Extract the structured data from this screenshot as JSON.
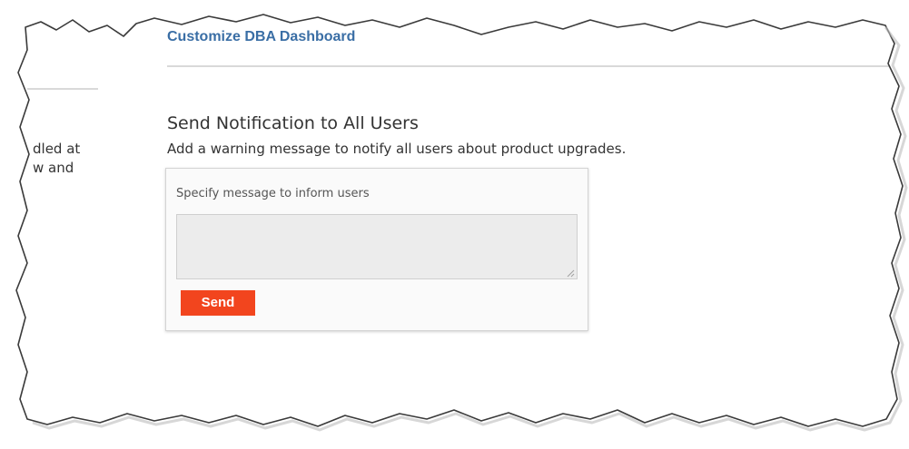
{
  "header": {
    "tab_label": "Customize DBA Dashboard"
  },
  "left_panel": {
    "fragment_line_1": "dled at",
    "fragment_line_2": "w and"
  },
  "notification": {
    "title": "Send Notification to All Users",
    "description": "Add a warning message to notify all users about product upgrades.",
    "field_label": "Specify message to inform users",
    "message_value": "",
    "send_label": "Send"
  },
  "colors": {
    "tab_link": "#3a6ea5",
    "send_button": "#f2451e",
    "text": "#333333"
  },
  "icons": {
    "resize_grip": "resize-grip-icon"
  }
}
